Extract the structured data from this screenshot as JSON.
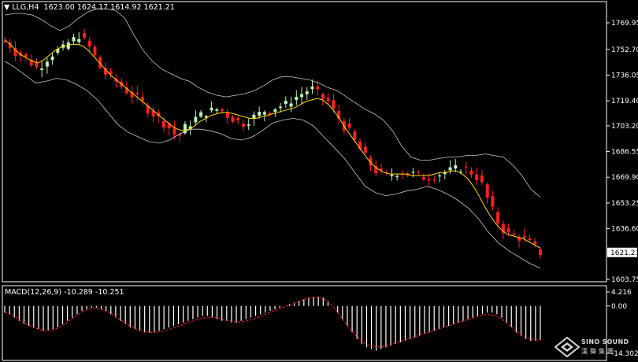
{
  "symbol_header": {
    "symbol": "LLG,H4",
    "open": "1623.00",
    "high": "1624.17",
    "low": "1614.92",
    "close": "1621.21"
  },
  "macd_header": {
    "label": "MACD(12,26,9)",
    "main": "-10.289",
    "signal": "-10.251"
  },
  "logo": {
    "name": "SINO SOUND",
    "sub": "漢聲集團"
  },
  "colors": {
    "background": "#000000",
    "bull": "#b9f5b4",
    "bear": "#ff2020",
    "bands": "#c8c8c8",
    "ma": "#ffd700",
    "macd_hist": "#ffffff",
    "macd_signal": "#ff2020",
    "axis": "#ffffff",
    "price_label_bg": "#ffffff"
  },
  "chart_data": [
    {
      "type": "candlestick",
      "title": "",
      "yticks": [
        "1769.95",
        "1752.70",
        "1736.05",
        "1719.40",
        "1703.20",
        "1686.55",
        "1669.90",
        "1653.25",
        "1636.60",
        "1603.75"
      ],
      "ylim": [
        1600,
        1780
      ],
      "current_price": "1621.21",
      "overlays": [
        "Bollinger Bands",
        "Moving Average"
      ],
      "close_path": [
        1758,
        1755,
        1751,
        1749,
        1747,
        1744,
        1741,
        1743,
        1747,
        1750,
        1752,
        1753,
        1757,
        1759,
        1762,
        1758,
        1754,
        1748,
        1741,
        1737,
        1734,
        1732,
        1729,
        1726,
        1723,
        1721,
        1718,
        1714,
        1711,
        1708,
        1705,
        1702,
        1698,
        1697,
        1702,
        1705,
        1708,
        1710,
        1712,
        1713,
        1714,
        1713,
        1710,
        1708,
        1706,
        1705,
        1707,
        1709,
        1711,
        1713,
        1713,
        1715,
        1716,
        1717,
        1720,
        1722,
        1724,
        1726,
        1727,
        1724,
        1721,
        1719,
        1713,
        1708,
        1703,
        1699,
        1693,
        1688,
        1683,
        1678,
        1674,
        1672,
        1671,
        1672,
        1673,
        1673,
        1672,
        1672,
        1671,
        1670,
        1670,
        1671,
        1672,
        1673,
        1674,
        1675,
        1676,
        1675,
        1673,
        1670,
        1665,
        1656,
        1648,
        1641,
        1636,
        1633,
        1632,
        1631,
        1629,
        1627,
        1624,
        1621
      ],
      "bollinger_upper_path": [
        1775,
        1776,
        1776,
        1775,
        1772,
        1768,
        1765,
        1768,
        1773,
        1777,
        1779,
        1779,
        1778,
        1773,
        1762,
        1752,
        1745,
        1740,
        1737,
        1734,
        1732,
        1728,
        1725,
        1723,
        1722,
        1723,
        1724,
        1726,
        1729,
        1733,
        1735,
        1735,
        1734,
        1733,
        1731,
        1728,
        1726,
        1722,
        1718,
        1714,
        1711,
        1707,
        1700,
        1690,
        1683,
        1681,
        1681,
        1682,
        1683,
        1683,
        1684,
        1684,
        1685,
        1684,
        1683,
        1678,
        1671,
        1662,
        1657
      ],
      "bollinger_upper_x_start": 0,
      "bollinger_lower_path": [
        1745,
        1741,
        1736,
        1731,
        1732,
        1734,
        1733,
        1730,
        1726,
        1720,
        1712,
        1704,
        1699,
        1696,
        1693,
        1692,
        1694,
        1698,
        1701,
        1701,
        1700,
        1698,
        1695,
        1694,
        1696,
        1700,
        1705,
        1707,
        1708,
        1707,
        1703,
        1696,
        1689,
        1682,
        1673,
        1664,
        1660,
        1658,
        1659,
        1661,
        1662,
        1664,
        1662,
        1659,
        1655,
        1650,
        1643,
        1634,
        1627,
        1622,
        1618,
        1614,
        1611
      ],
      "ma_path": [
        1759,
        1756,
        1752,
        1749,
        1747,
        1745,
        1744,
        1746,
        1749,
        1752,
        1754,
        1755,
        1756,
        1756,
        1755,
        1752,
        1748,
        1744,
        1740,
        1736,
        1733,
        1730,
        1727,
        1724,
        1721,
        1718,
        1715,
        1712,
        1709,
        1706,
        1703,
        1701,
        1700,
        1701,
        1703,
        1706,
        1708,
        1710,
        1711,
        1712,
        1712,
        1711,
        1710,
        1709,
        1708,
        1708,
        1709,
        1710,
        1711,
        1712,
        1713,
        1714,
        1715,
        1717,
        1719,
        1720,
        1721,
        1720,
        1717,
        1713,
        1708,
        1702,
        1697,
        1692,
        1687,
        1682,
        1678,
        1675,
        1673,
        1672,
        1672,
        1672,
        1672,
        1671,
        1671,
        1671,
        1671,
        1672,
        1673,
        1673,
        1674,
        1674,
        1672,
        1669,
        1664,
        1658,
        1651,
        1645,
        1640,
        1636,
        1633,
        1632,
        1631,
        1630,
        1628,
        1626,
        1624
      ]
    },
    {
      "type": "bar",
      "title": "MACD(12,26,9)",
      "yticks": [
        "4.216",
        "0.00",
        "-14.302"
      ],
      "ylim": [
        -14.302,
        4.216
      ],
      "histogram": [
        -2,
        -2.5,
        -3.5,
        -4.5,
        -5.5,
        -6,
        -6.5,
        -7,
        -7.5,
        -7.5,
        -7,
        -6.5,
        -5.5,
        -4.5,
        -3.5,
        -2.5,
        -1.5,
        -1,
        -0.5,
        -0.5,
        -1,
        -1.5,
        -2.5,
        -3.5,
        -4.5,
        -5.5,
        -6.5,
        -7,
        -7.5,
        -8,
        -8,
        -8,
        -7.5,
        -7,
        -6.5,
        -6,
        -5.5,
        -5,
        -4.5,
        -4,
        -3.5,
        -3,
        -3,
        -3.5,
        -4,
        -4.5,
        -4.5,
        -5,
        -5,
        -4.5,
        -4,
        -3.5,
        -3,
        -2.5,
        -2,
        -1.5,
        -1,
        -0.5,
        0,
        0.5,
        1,
        1.5,
        2,
        2.5,
        2.8,
        2.8,
        2.5,
        1.5,
        0,
        -2,
        -4,
        -6,
        -8,
        -10,
        -11.5,
        -12.5,
        -13,
        -13.5,
        -13,
        -12.5,
        -12,
        -11.5,
        -11,
        -10.5,
        -10,
        -9.5,
        -9,
        -8.5,
        -8,
        -7.5,
        -7,
        -6.5,
        -6,
        -5.5,
        -5,
        -4.5,
        -4,
        -3.5,
        -3,
        -2.5,
        -2,
        -2,
        -2.5,
        -3.5,
        -5,
        -6.5,
        -8,
        -9,
        -10,
        -10.5,
        -10.5,
        -10.3
      ],
      "signal_path": [
        -2,
        -2.5,
        -3.2,
        -4.2,
        -5.2,
        -6,
        -6.7,
        -7.2,
        -7.5,
        -7.4,
        -7,
        -6.2,
        -5.2,
        -4.1,
        -3,
        -2,
        -1.2,
        -0.8,
        -0.7,
        -1,
        -1.6,
        -2.5,
        -3.5,
        -4.5,
        -5.5,
        -6.4,
        -7.1,
        -7.6,
        -7.9,
        -8,
        -7.9,
        -7.6,
        -7.2,
        -6.7,
        -6.2,
        -5.6,
        -5,
        -4.5,
        -4,
        -3.6,
        -3.4,
        -3.4,
        -3.7,
        -4.1,
        -4.5,
        -4.8,
        -4.9,
        -4.7,
        -4.3,
        -3.8,
        -3.2,
        -2.6,
        -2,
        -1.4,
        -0.8,
        -0.2,
        0.4,
        1,
        1.6,
        2.1,
        2.5,
        2.6,
        2.4,
        1.7,
        0.4,
        -1.4,
        -3.5,
        -5.6,
        -7.6,
        -9.3,
        -10.6,
        -11.6,
        -12.2,
        -12.4,
        -12.3,
        -12,
        -11.5,
        -11,
        -10.5,
        -10,
        -9.5,
        -9,
        -8.5,
        -8,
        -7.5,
        -7,
        -6.5,
        -6,
        -5.5,
        -5,
        -4.5,
        -4,
        -3.5,
        -3,
        -2.7,
        -2.6,
        -2.8,
        -3.5,
        -4.6,
        -5.9,
        -7.2,
        -8.4,
        -9.3,
        -9.9,
        -10.2,
        -10.251
      ]
    }
  ]
}
